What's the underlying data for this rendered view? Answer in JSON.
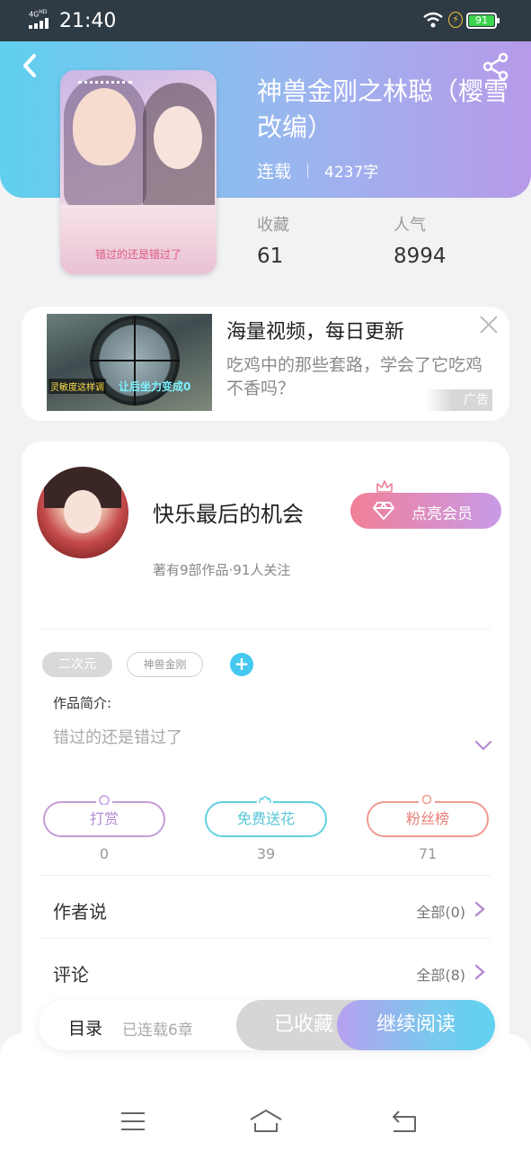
{
  "status_bar": {
    "network": "4G",
    "network_sub": "HD",
    "time": "21:40",
    "battery": "91"
  },
  "book": {
    "title": "神兽金刚之林聪（樱雪改编）",
    "status": "连载",
    "words": "4237字",
    "cover_text": "错过的还是错过了",
    "stats": [
      {
        "label": "收藏",
        "value": "61"
      },
      {
        "label": "人气",
        "value": "8994"
      }
    ]
  },
  "ad": {
    "title": "海量视频，每日更新",
    "description": "吃鸡中的那些套路，学会了它吃鸡不香吗？",
    "badge": "广告",
    "thumb_text_1": "灵敏度这样调",
    "thumb_text_2": "让后坐力变成0"
  },
  "author": {
    "name": "快乐最后的机会",
    "sub": "著有9部作品·91人关注",
    "vip_label": "点亮会员"
  },
  "tags": [
    "二次元",
    "神兽金刚"
  ],
  "intro": {
    "label": "作品简介:",
    "text": "错过的还是错过了"
  },
  "actions": [
    {
      "label": "打赏",
      "count": "0"
    },
    {
      "label": "免费送花",
      "count": "39"
    },
    {
      "label": "粉丝榜",
      "count": "71"
    }
  ],
  "rows": [
    {
      "label": "作者说",
      "value": "全部(0)"
    },
    {
      "label": "评论",
      "value": "全部(8)"
    }
  ],
  "bottom_bar": {
    "menu": "目录",
    "chapters": "已连载6章",
    "favorited": "已收藏",
    "read": "继续阅读"
  },
  "colors": {
    "header_start": "#5fd0ee",
    "header_end": "#b79ae9",
    "accent_cyan": "#45c8f0",
    "vip_pink": "#f18098"
  }
}
